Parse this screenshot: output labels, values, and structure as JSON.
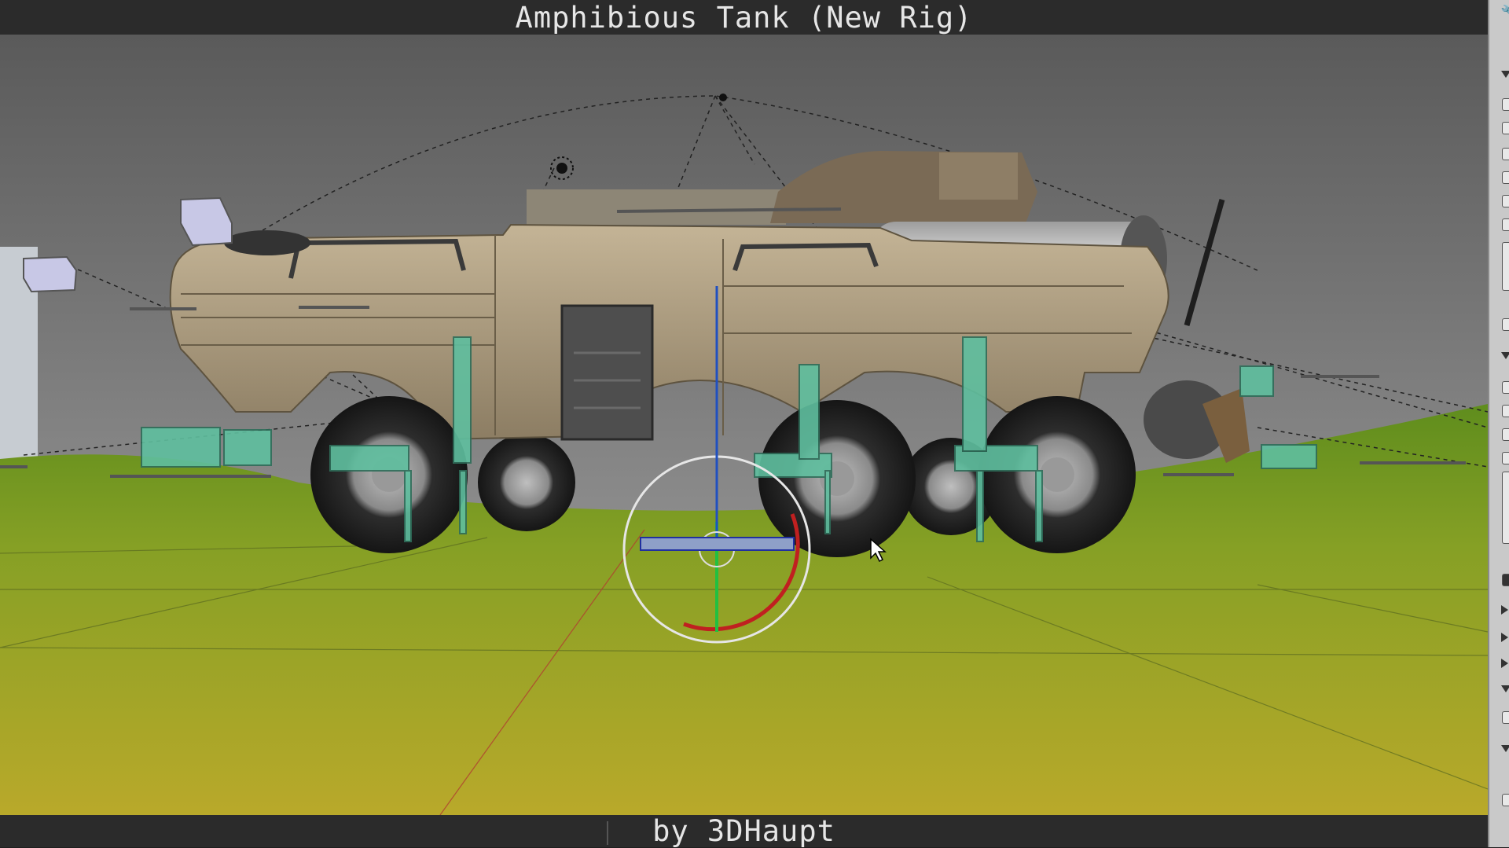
{
  "title": "Amphibious Tank (New Rig)",
  "credit": "by 3DHaupt",
  "colors": {
    "sky_top": "#5c5c5c",
    "sky_bottom": "#a8a8a8",
    "grass": "#6f9a1e",
    "ground": "#b2a62a",
    "hull": "#a99a7e",
    "rig_bone": "#5fbf9f",
    "title_bar": "#2b2b2b"
  },
  "side_panel": {
    "icons": [
      "wrench-icon",
      "collapse-arrow-icon",
      "checkbox-icon"
    ]
  }
}
